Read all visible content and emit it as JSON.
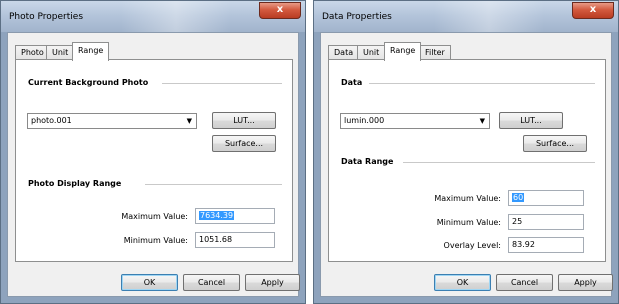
{
  "left_dialog": {
    "title": "Photo Properties",
    "close_label": "x",
    "tabs": [
      "Photo",
      "Unit",
      "Range"
    ],
    "active_tab": "Range",
    "section1": {
      "title": "Current Background Photo",
      "combo_value": "photo.001",
      "lut_label": "LUT...",
      "surface_label": "Surface..."
    },
    "section2": {
      "title": "Photo Display Range",
      "max_label": "Maximum Value:",
      "max_value": "7634.39",
      "min_label": "Minimum Value:",
      "min_value": "1051.68"
    },
    "ok_label": "OK",
    "cancel_label": "Cancel",
    "apply_label": "Apply"
  },
  "right_dialog": {
    "title": "Data Properties",
    "close_label": "x",
    "tabs": [
      "Data",
      "Unit",
      "Range",
      "Filter"
    ],
    "active_tab": "Range",
    "section1": {
      "title": "Data",
      "combo_value": "lumin.000",
      "lut_label": "LUT...",
      "surface_label": "Surface..."
    },
    "section2": {
      "title": "Data Range",
      "max_label": "Maximum Value:",
      "max_value": "60",
      "min_label": "Minimum Value:",
      "min_value": "25",
      "overlay_label": "Overlay Level:",
      "overlay_value": "83.92"
    },
    "ok_label": "OK",
    "cancel_label": "Cancel",
    "apply_label": "Apply"
  },
  "colors": {
    "selection": "#3399ff",
    "close_button": "#c9472c",
    "titlebar": "#b4c5db"
  }
}
